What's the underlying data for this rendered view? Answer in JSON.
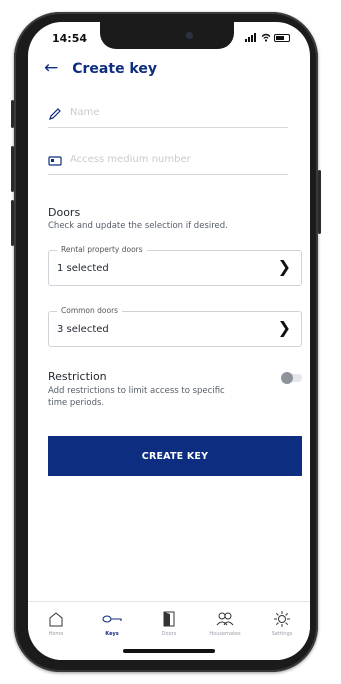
{
  "status": {
    "time": "14:54"
  },
  "header": {
    "back_icon": "back-arrow-icon",
    "title": "Create key"
  },
  "form": {
    "name_placeholder": "Name",
    "access_medium_placeholder": "Access medium number"
  },
  "doors": {
    "title": "Doors",
    "subtitle": "Check and update the selection if desired.",
    "rental": {
      "label": "Rental property doors",
      "value": "1 selected"
    },
    "common": {
      "label": "Common doors",
      "value": "3 selected"
    }
  },
  "restriction": {
    "title": "Restriction",
    "subtitle": "Add restrictions to limit access to specific time periods.",
    "enabled": false
  },
  "create_button": "CREATE KEY",
  "tabs": [
    {
      "label": "Home",
      "icon": "house-icon",
      "active": false
    },
    {
      "label": "Keys",
      "icon": "key-icon",
      "active": true
    },
    {
      "label": "Doors",
      "icon": "door-icon",
      "active": false
    },
    {
      "label": "Housemates",
      "icon": "people-icon",
      "active": false
    },
    {
      "label": "Settings",
      "icon": "gear-icon",
      "active": false
    }
  ],
  "colors": {
    "accent": "#0d2d80",
    "text": "#1f2630",
    "muted": "#555d68",
    "border": "#cfd3d9"
  }
}
